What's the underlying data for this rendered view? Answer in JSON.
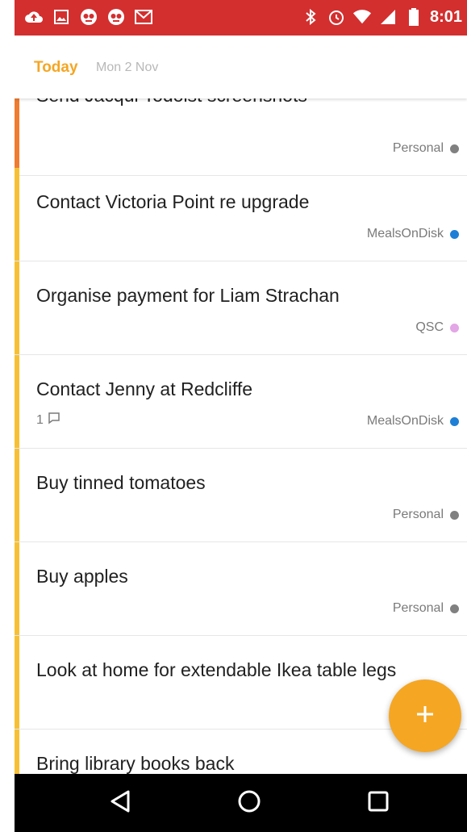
{
  "status_bar": {
    "time": "8:01",
    "icons_left": [
      "upload-icon",
      "image-icon",
      "app-icon",
      "app-icon",
      "gmail-icon"
    ],
    "icons_right": [
      "bluetooth-icon",
      "alarm-icon",
      "wifi-icon",
      "signal-icon",
      "battery-icon"
    ],
    "bg_color": "#d32f2f"
  },
  "header": {
    "title": "Today",
    "date": "Mon 2 Nov",
    "accent": "#f5a623"
  },
  "tasks": [
    {
      "title": "Send Jacqui Todoist screenshots",
      "project": "Personal",
      "project_color": "#808080",
      "priority_color": "#ef7c30"
    },
    {
      "title": "Contact Victoria Point re upgrade",
      "project": "MealsOnDisk",
      "project_color": "#1e7fd6",
      "priority_color": "#f7c034"
    },
    {
      "title": "Organise payment for Liam Strachan",
      "project": "QSC",
      "project_color": "#e3a6e6",
      "priority_color": "#f7c034"
    },
    {
      "title": "Contact Jenny at Redcliffe",
      "project": "MealsOnDisk",
      "project_color": "#1e7fd6",
      "priority_color": "#f7c034",
      "comments": "1"
    },
    {
      "title": "Buy tinned tomatoes",
      "project": "Personal",
      "project_color": "#808080",
      "priority_color": "#f7c034"
    },
    {
      "title": "Buy apples",
      "project": "Personal",
      "project_color": "#808080",
      "priority_color": "#f7c034"
    },
    {
      "title": "Look at home for extendable Ikea table legs",
      "project": "",
      "project_color": "#d9342b",
      "priority_color": "#f7c034"
    },
    {
      "title": "Bring library books back",
      "project": "",
      "project_color": "",
      "priority_color": "#f7c034"
    }
  ],
  "fab": {
    "icon": "plus-icon",
    "color": "#f5a623"
  },
  "nav_bar": {
    "buttons": [
      "back-icon",
      "home-icon",
      "recents-icon"
    ]
  }
}
